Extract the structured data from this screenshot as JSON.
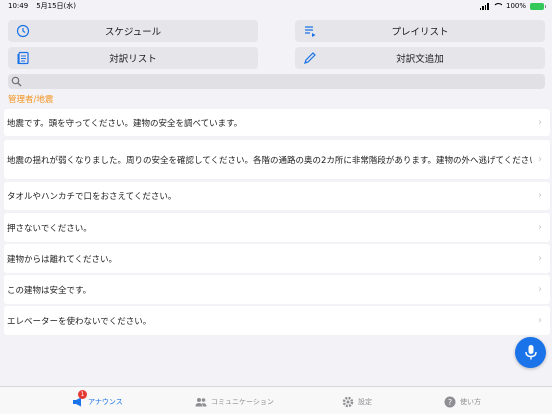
{
  "status_bar": {
    "time": "10:49",
    "date": "5月15日(水)",
    "battery": "100%"
  },
  "toolbar": {
    "schedule_label": "スケジュール",
    "playlist_label": "プレイリスト",
    "phrase_list_label": "対訳リスト",
    "add_phrase_label": "対訳文追加"
  },
  "search": {
    "placeholder": "",
    "value": ""
  },
  "section": {
    "title": "管理者/地震"
  },
  "phrases": [
    "地震です。頭を守ってください。建物の安全を調べています。",
    "地震の揺れが弱くなりました。周りの安全を確認してください。各階の通路の奥の2カ所に非常階段があります。建物の外へ逃げてください。",
    "タオルやハンカチで口をおさえてください。",
    "押さないでください。",
    "建物からは離れてください。",
    "この建物は安全です。",
    "エレベーターを使わないでください。"
  ],
  "tabbar": {
    "tabs": [
      {
        "label": "アナウンス",
        "badge": "1"
      },
      {
        "label": "コミュニケーション"
      },
      {
        "label": "設定"
      },
      {
        "label": "使い方"
      }
    ]
  },
  "colors": {
    "accent": "#1a73e8",
    "section_header": "#f5941e",
    "badge": "#e53935"
  }
}
